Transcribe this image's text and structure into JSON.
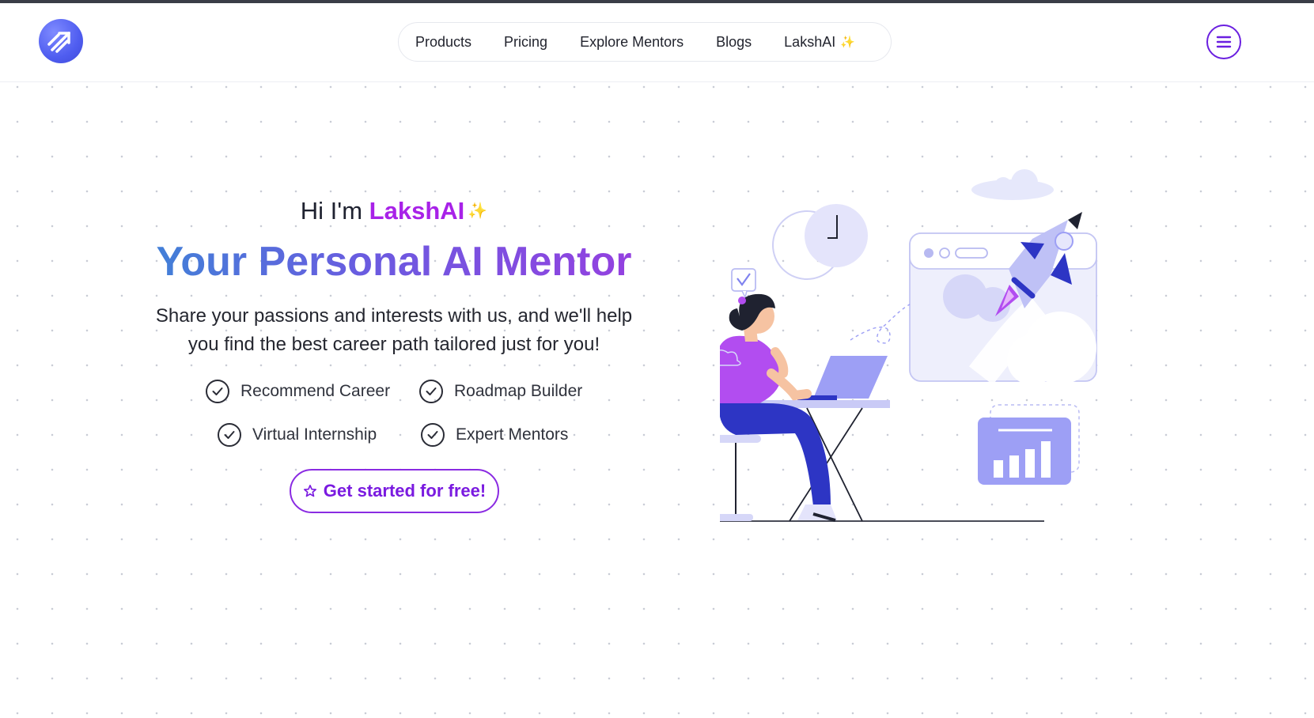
{
  "header": {
    "logo_icon": "arrows-up-right-icon",
    "nav": [
      {
        "label": "Products"
      },
      {
        "label": "Pricing"
      },
      {
        "label": "Explore Mentors"
      },
      {
        "label": "Blogs"
      },
      {
        "label": "LakshAI"
      }
    ],
    "nav_sparkle": "✨",
    "menu_icon": "hamburger-menu-icon"
  },
  "hero": {
    "greeting": "Hi I'm",
    "brand": "LakshAI",
    "greeting_sparkle": "✨",
    "headline": "Your Personal AI Mentor",
    "subtitle_line1": "Share your passions and interests with us, and we'll help",
    "subtitle_line2": "you find the best career path tailored just for you!",
    "features": [
      {
        "label": "Recommend Career"
      },
      {
        "label": "Roadmap Builder"
      },
      {
        "label": "Virtual Internship"
      },
      {
        "label": "Expert Mentors"
      }
    ],
    "cta_label": "Get started for free!",
    "cta_icon": "star-icon"
  },
  "colors": {
    "accent_purple": "#a822e8",
    "cta_purple": "#7a1ae0",
    "gradient_start": "#3b86d6",
    "gradient_end": "#9a3de0",
    "illustration_lavender": "#9d9ff5",
    "illustration_blue": "#2d35c4"
  }
}
